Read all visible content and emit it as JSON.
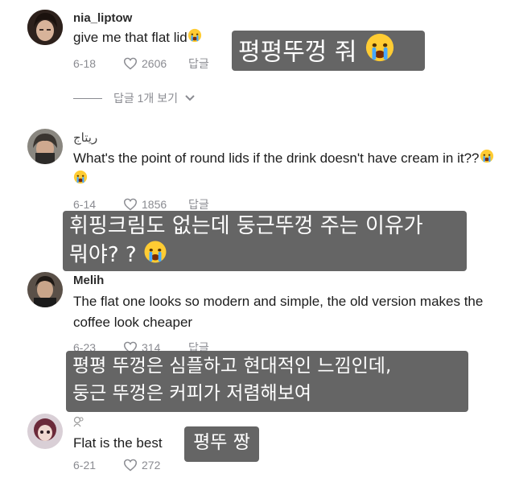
{
  "comments": [
    {
      "username": "nia_liptow",
      "text": "give me that flat lid",
      "date": "6-18",
      "likes": "2606",
      "reply_label": "답글",
      "overlay": [
        "평평뚜껑 줘"
      ]
    },
    {
      "username": "ريتاج",
      "text": "What's the point of round lids if the drink doesn't have cream in it??",
      "date": "6-14",
      "likes": "1856",
      "reply_label": "답글",
      "overlay": [
        "휘핑크림도 없는데 둥근뚜껑 주는 이유가",
        "뭐야? ?"
      ]
    },
    {
      "username": "Melih",
      "text": "The flat one looks so modern and simple, the old version makes the coffee look cheaper",
      "date": "6-23",
      "likes": "314",
      "reply_label": "답글",
      "overlay": [
        "평평 뚜껑은 심플하고 현대적인 느낌인데,",
        "둥근 뚜껑은 커피가 저렴해보여"
      ]
    },
    {
      "username": "",
      "text": "Flat is the best",
      "date": "6-21",
      "likes": "272",
      "reply_label": "",
      "overlay": [
        "평뚜 짱"
      ]
    }
  ],
  "view_replies_label": "답글 1개 보기",
  "icons": [
    "heart-icon",
    "crying-face-emoji",
    "chevron-down-icon"
  ],
  "colors": {
    "text": "#1c1c1c",
    "meta": "#8a8b91",
    "overlay_bg": "#585858",
    "overlay_text": "#ffffff"
  }
}
